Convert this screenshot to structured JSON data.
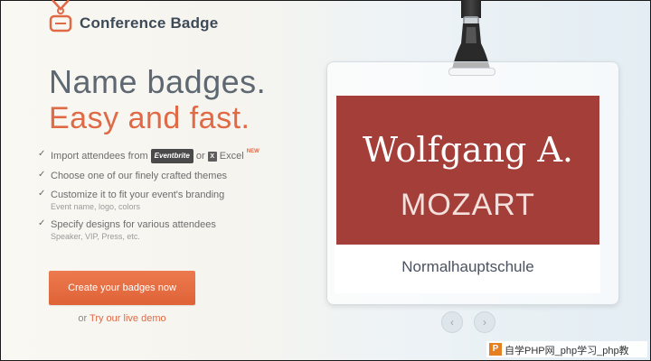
{
  "brand": {
    "name": "Conference Badge"
  },
  "hero": {
    "line1": "Name badges.",
    "line2": "Easy and fast."
  },
  "features": [
    {
      "main_prefix": "Import attendees from",
      "eventbrite": "Eventbrite",
      "or": "or",
      "excel_icon": "X",
      "excel": "Excel",
      "new": "NEW"
    },
    {
      "main": "Choose one of our finely crafted themes"
    },
    {
      "main": "Customize it to fit your event's branding",
      "sub": "Event name, logo, colors"
    },
    {
      "main": "Specify designs for various attendees",
      "sub": "Speaker, VIP, Press, etc."
    }
  ],
  "cta": {
    "label": "Create your badges now"
  },
  "demo": {
    "prefix": "or",
    "link": "Try our live demo"
  },
  "badge": {
    "first_name": "Wolfgang A.",
    "last_name": "MOZART",
    "organization": "Normalhauptschule"
  },
  "nav": {
    "prev": "‹",
    "next": "›"
  },
  "watermark": {
    "logo": "P",
    "text": "自学PHP网_php学习_php教"
  },
  "colors": {
    "accent": "#e06a46",
    "badge_red": "#a43e38",
    "headline_gray": "#5e6872"
  },
  "icons": {
    "logo": "lanyard-badge-icon",
    "check": "check-icon",
    "clip": "lanyard-clip-icon"
  }
}
